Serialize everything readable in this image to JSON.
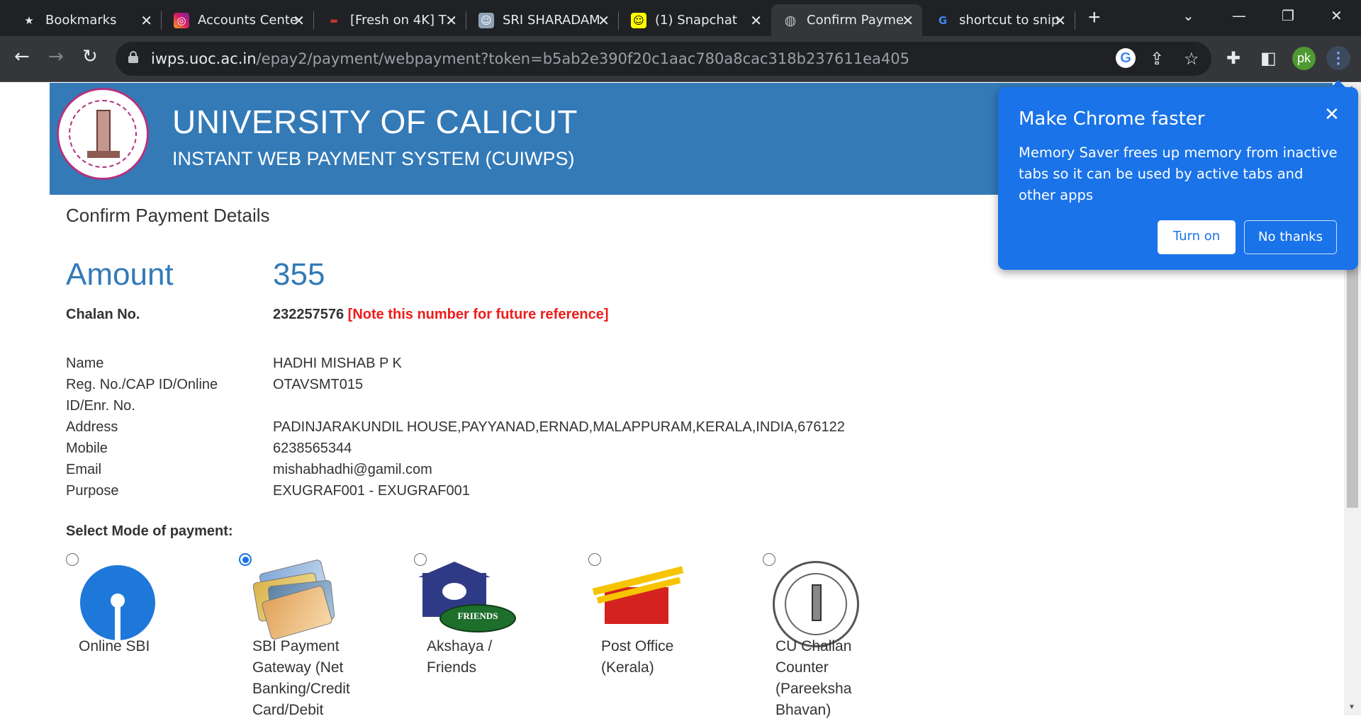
{
  "browser": {
    "tabs": [
      {
        "title": "Bookmarks",
        "icon": "star-icon",
        "active": false
      },
      {
        "title": "Accounts Cente",
        "icon": "instagram-icon",
        "active": false
      },
      {
        "title": "[Fresh on 4K] T",
        "icon": "youtube-icon",
        "active": false
      },
      {
        "title": "SRI SHARADAM",
        "icon": "photo-icon",
        "active": false
      },
      {
        "title": "(1) Snapchat",
        "icon": "snapchat-icon",
        "active": false
      },
      {
        "title": "Confirm Payme",
        "icon": "globe-icon",
        "active": true
      },
      {
        "title": "shortcut to snip",
        "icon": "google-icon",
        "active": false
      }
    ],
    "url_host": "iwps.uoc.ac.in",
    "url_path": "/epay2/payment/webpayment?token=b5ab2e390f20c1aac780a8cac318b237611ea405",
    "profile_initials": "pk"
  },
  "page": {
    "uni_title": "UNIVERSITY OF CALICUT",
    "uni_subtitle": "INSTANT WEB PAYMENT SYSTEM (CUIWPS)",
    "confirm_heading": "Confirm Payment Details",
    "amount_label": "Amount",
    "amount_value": "355",
    "chalan_label": "Chalan No.",
    "chalan_value": "232257576",
    "chalan_note": "[Note this number for future reference]",
    "details": {
      "name_label": "Name",
      "name_value": "HADHI MISHAB P K",
      "reg_label": "Reg. No./CAP ID/Online ID/Enr. No.",
      "reg_value": "OTAVSMT015",
      "address_label": "Address",
      "address_value": "PADINJARAKUNDIL HOUSE,PAYYANAD,ERNAD,MALAPPURAM,KERALA,INDIA,676122",
      "mobile_label": "Mobile",
      "mobile_value": "6238565344",
      "email_label": "Email",
      "email_value": "mishabhadhi@gamil.com",
      "purpose_label": "Purpose",
      "purpose_value": "EXUGRAF001 - EXUGRAF001"
    },
    "mode_heading": "Select Mode of payment:",
    "payment_modes": [
      {
        "label": "Online SBI",
        "selected": false
      },
      {
        "label": "SBI Payment Gateway (Net Banking/Credit Card/Debit",
        "selected": true
      },
      {
        "label": "Akshaya / Friends",
        "selected": false
      },
      {
        "label": "Post Office (Kerala)",
        "selected": false
      },
      {
        "label": "CU Challan Counter (Pareeksha Bhavan)",
        "selected": false
      }
    ],
    "friends_logo_text": "FRIENDS"
  },
  "popup": {
    "title": "Make Chrome faster",
    "body": "Memory Saver frees up memory from inactive tabs so it can be used by active tabs and other apps",
    "turn_on": "Turn on",
    "no_thanks": "No thanks"
  },
  "colors": {
    "banner": "#337ab7",
    "amount": "#337ab7",
    "note_red": "#ee1c1c",
    "popup_blue": "#1a73e8"
  }
}
